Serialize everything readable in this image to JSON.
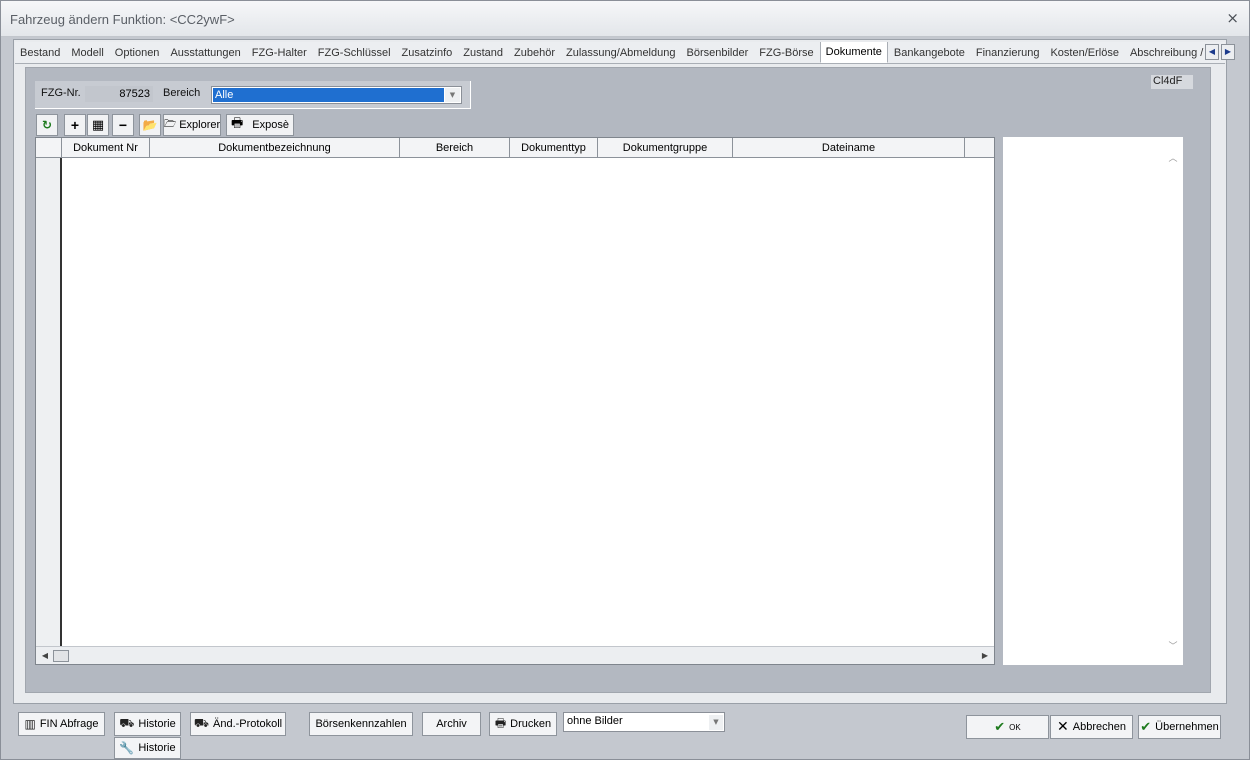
{
  "window": {
    "title": "Fahrzeug ändern   Funktion: <CC2ywF>",
    "close_glyph": "×"
  },
  "tabs": [
    {
      "label": "Bestand",
      "active": false
    },
    {
      "label": "Modell",
      "active": false
    },
    {
      "label": "Optionen",
      "active": false
    },
    {
      "label": "Ausstattungen",
      "active": false
    },
    {
      "label": "FZG-Halter",
      "active": false
    },
    {
      "label": "FZG-Schlüssel",
      "active": false
    },
    {
      "label": "Zusatzinfo",
      "active": false
    },
    {
      "label": "Zustand",
      "active": false
    },
    {
      "label": "Zubehör",
      "active": false
    },
    {
      "label": "Zulassung/Abmeldung",
      "active": false
    },
    {
      "label": "Börsenbilder",
      "active": false
    },
    {
      "label": "FZG-Börse",
      "active": false
    },
    {
      "label": "Dokumente",
      "active": true
    },
    {
      "label": "Bankangebote",
      "active": false
    },
    {
      "label": "Finanzierung",
      "active": false
    },
    {
      "label": "Kosten/Erlöse",
      "active": false
    },
    {
      "label": "Abschreibung / V",
      "active": false
    }
  ],
  "tab_nav": {
    "prev": "◀",
    "next": "▶"
  },
  "code_label": "Cl4dF",
  "filter": {
    "fzg_label": "FZG-Nr.",
    "fzg_value": "87523",
    "bereich_label": "Bereich",
    "bereich_value": "Alle"
  },
  "toolbar": {
    "refresh_glyph": "↻",
    "add_glyph": "+",
    "scan_glyph": "▦",
    "remove_glyph": "−",
    "open_glyph": "📂",
    "explorer_label": "Explorer",
    "expose_label": "Exposè",
    "print_glyph": "🖶"
  },
  "grid": {
    "columns": [
      "Dokument Nr",
      "Dokumentbezeichnung",
      "Bereich",
      "Dokumenttyp",
      "Dokumentgruppe",
      "Dateiname"
    ],
    "rows": []
  },
  "footer": {
    "fin_label": "FIN Abfrage",
    "historie_label": "Historie",
    "historie2_label": "Historie",
    "aend_label": "Änd.-Protokoll",
    "boersen_label": "Börsenkennzahlen",
    "archiv_label": "Archiv",
    "drucken_label": "Drucken",
    "bilder_value": "ohne Bilder",
    "ok_label": "OK",
    "abbrechen_label": "Abbrechen",
    "uebernehmen_label": "Übernehmen"
  },
  "colors": {
    "accent": "#1f6fd0",
    "ok_green": "#1d7a1d"
  }
}
